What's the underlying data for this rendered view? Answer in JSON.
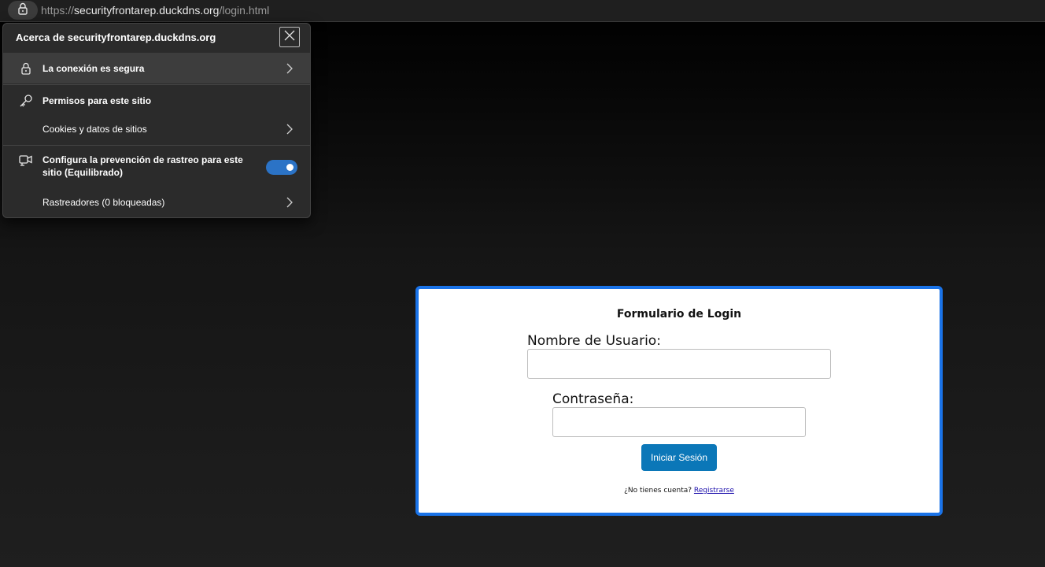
{
  "address_bar": {
    "url_protocol": "https://",
    "url_host": "securityfrontarep.duckdns.org",
    "url_path": "/login.html",
    "lock_icon": "lock-icon"
  },
  "site_info": {
    "title": "Acerca de securityfrontarep.duckdns.org",
    "close_icon": "close-icon",
    "secure_label": "La conexión es segura",
    "permissions_label": "Permisos para este sitio",
    "cookies_label": "Cookies y datos de sitios",
    "tracking_label": "Configura la prevención de rastreo para este sitio (Equilibrado)",
    "tracking_enabled": true,
    "trackers_label": "Rastreadores (0 bloqueadas)",
    "toggle_color": "#2b73c6"
  },
  "login": {
    "title": "Formulario de Login",
    "username_label": "Nombre de Usuario:",
    "username_value": "",
    "password_label": "Contraseña:",
    "password_value": "",
    "submit_label": "Iniciar Sesión",
    "signup_prompt": "¿No tienes cuenta?",
    "signup_link": "Registrarse",
    "accent_color": "#1a73e8",
    "button_color": "#0b77b8"
  }
}
